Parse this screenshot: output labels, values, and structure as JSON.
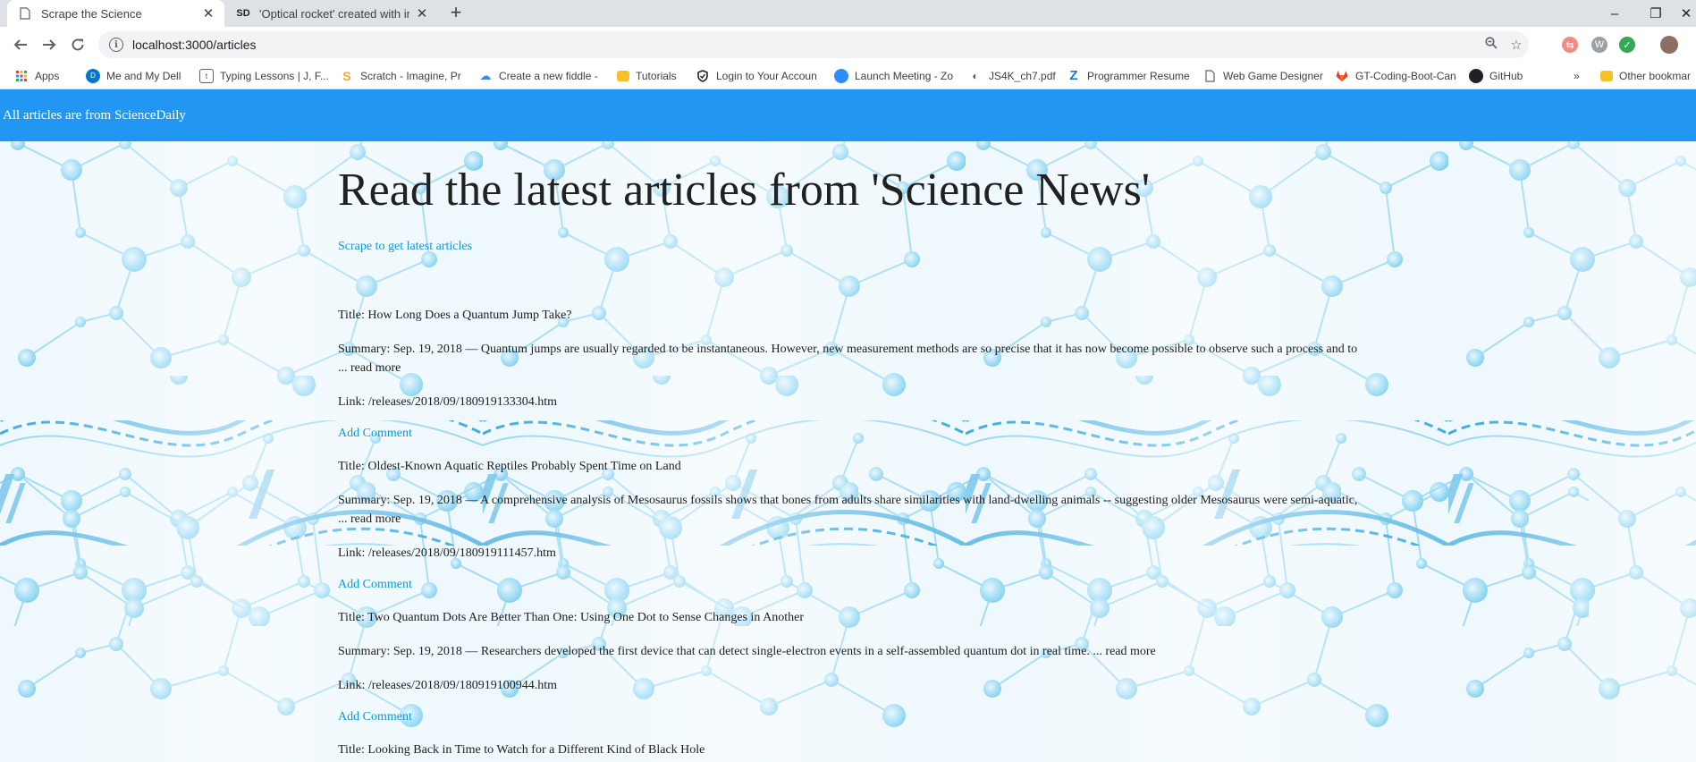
{
  "browser": {
    "tabs": [
      {
        "title": "Scrape the Science",
        "icon": "page-icon"
      },
      {
        "title": "'Optical rocket' created with inte",
        "icon": "sd-icon"
      }
    ],
    "new_tab": "+",
    "window_controls": {
      "minimize": "–",
      "maximize": "❐",
      "close": "✕"
    },
    "url": "localhost:3000/articles",
    "bookmarks": [
      {
        "label": "Apps",
        "icon": "apps-grid-icon",
        "color": "#ea4335"
      },
      {
        "label": "Me and My Dell",
        "icon": "dell-icon",
        "color": "#0076ce"
      },
      {
        "label": "Typing Lessons | J, F...",
        "icon": "typing-icon",
        "color": "#5f6368"
      },
      {
        "label": "Scratch - Imagine, Pr",
        "icon": "scratch-icon",
        "color": "#f9a825"
      },
      {
        "label": "Create a new fiddle -",
        "icon": "cloud-icon",
        "color": "#4285f4"
      },
      {
        "label": "Tutorials",
        "icon": "folder-icon",
        "color": "#f6c026"
      },
      {
        "label": "Login to Your Accoun",
        "icon": "shield-icon",
        "color": "#202124"
      },
      {
        "label": "Launch Meeting - Zo",
        "icon": "zoom-icon",
        "color": "#2d8cff"
      },
      {
        "label": "JS4K_ch7.pdf",
        "icon": "pdf-icon",
        "color": "#5f6368"
      },
      {
        "label": "Programmer Resume",
        "icon": "z-icon",
        "color": "#1a73e8"
      },
      {
        "label": "Web Game Designer",
        "icon": "doc-icon",
        "color": "#5f6368"
      },
      {
        "label": "GT-Coding-Boot-Can",
        "icon": "gitlab-icon",
        "color": "#e24329"
      },
      {
        "label": "GitHub",
        "icon": "github-icon",
        "color": "#202124"
      }
    ],
    "more": "»",
    "other_bookmarks": "Other bookmar"
  },
  "navbar": {
    "brand": "All articles are from ScienceDaily"
  },
  "main": {
    "heading": "Read the latest articles from 'Science News'",
    "scrape_link": "Scrape to get latest articles"
  },
  "articles": [
    {
      "title": "Title: How Long Does a Quantum Jump Take?",
      "summary": "Summary: Sep. 19, 2018 — Quantum jumps are usually regarded to be instantaneous. However, new measurement methods are so precise that it has now become possible to observe such a process and to ... read more",
      "link": "Link: /releases/2018/09/180919133304.htm",
      "add_comment": "Add Comment"
    },
    {
      "title": "Title: Oldest-Known Aquatic Reptiles Probably Spent Time on Land",
      "summary": "Summary: Sep. 19, 2018 — A comprehensive analysis of Mesosaurus fossils shows that bones from adults share similarities with land-dwelling animals -- suggesting older Mesosaurus were semi-aquatic, ... read more",
      "link": "Link: /releases/2018/09/180919111457.htm",
      "add_comment": "Add Comment"
    },
    {
      "title": "Title: Two Quantum Dots Are Better Than One: Using One Dot to Sense Changes in Another",
      "summary": "Summary: Sep. 19, 2018 — Researchers developed the first device that can detect single-electron events in a self-assembled quantum dot in real time. ... read more",
      "link": "Link: /releases/2018/09/180919100944.htm",
      "add_comment": "Add Comment"
    },
    {
      "title": "Title: Looking Back in Time to Watch for a Different Kind of Black Hole"
    }
  ],
  "colors": {
    "navbar": "#2196f3",
    "link": "#039be5",
    "text": "#212121"
  }
}
